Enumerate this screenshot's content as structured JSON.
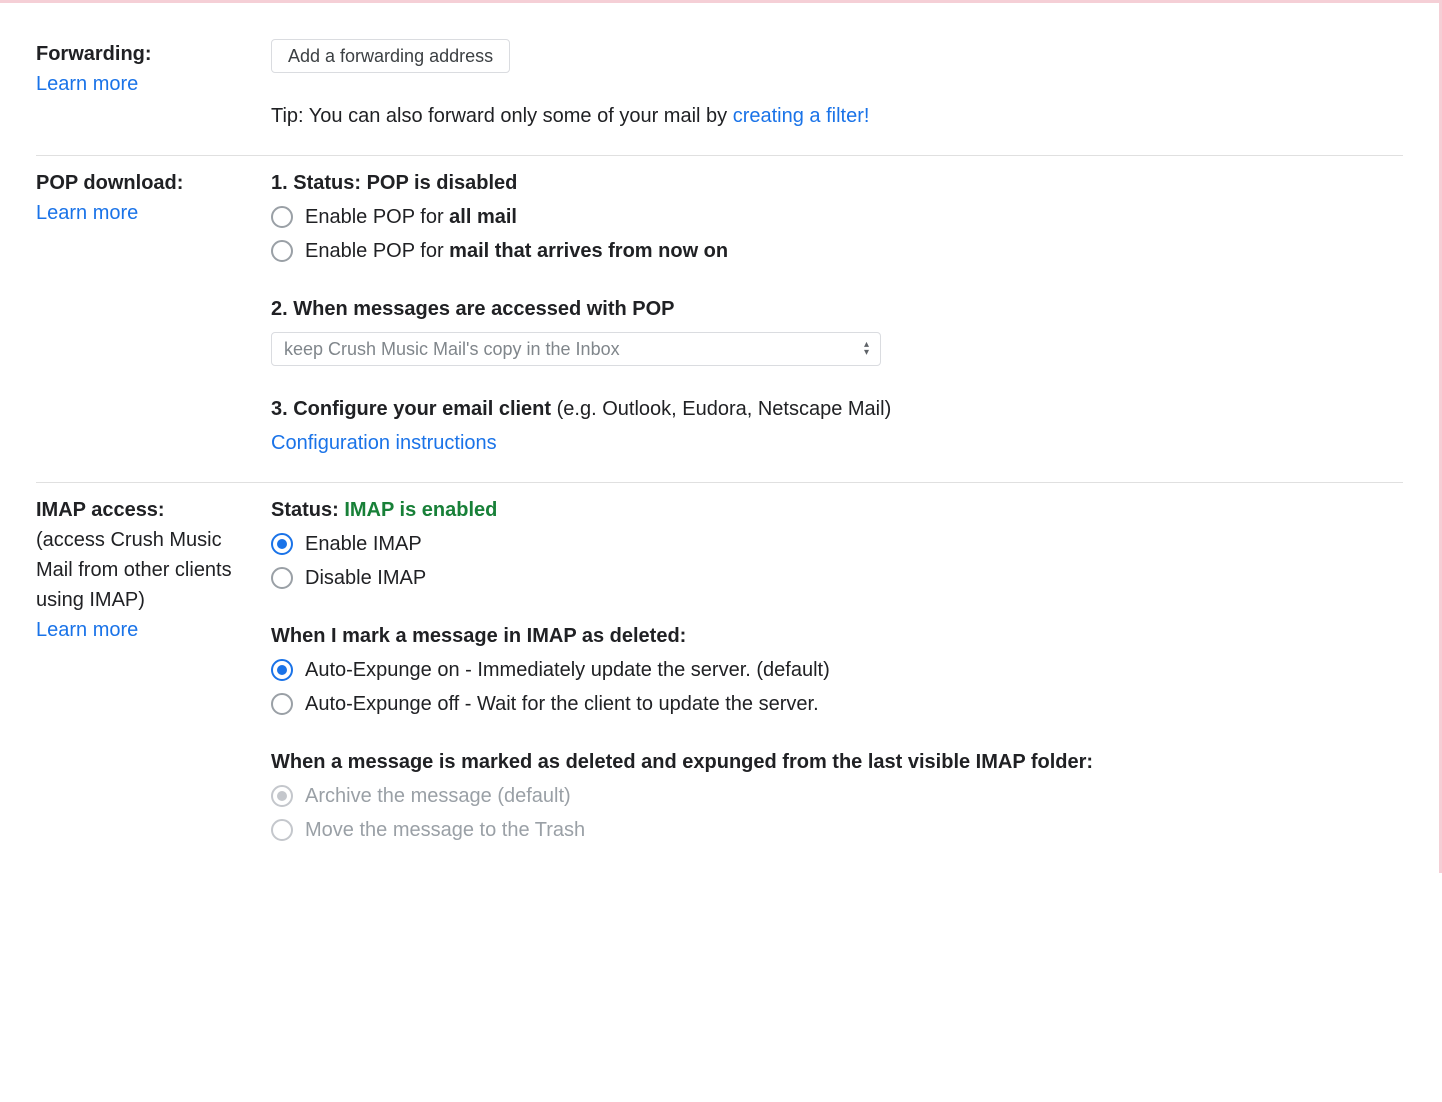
{
  "forwarding": {
    "title": "Forwarding:",
    "learn_more": "Learn more",
    "button_label": "Add a forwarding address",
    "tip_prefix": "Tip: You can also forward only some of your mail by ",
    "tip_link": "creating a filter!"
  },
  "pop": {
    "title": "POP download:",
    "learn_more": "Learn more",
    "status_prefix": "1. Status: ",
    "status_value": "POP is disabled",
    "opt_all_prefix": "Enable POP for ",
    "opt_all_bold": "all mail",
    "opt_now_prefix": "Enable POP for ",
    "opt_now_bold": "mail that arrives from now on",
    "step2": "2. When messages are accessed with POP",
    "select_value": "keep Crush Music Mail's copy in the Inbox",
    "step3_bold": "3. Configure your email client ",
    "step3_rest": "(e.g. Outlook, Eudora, Netscape Mail)",
    "config_link": "Configuration instructions"
  },
  "imap": {
    "title": "IMAP access:",
    "desc": "(access Crush Music Mail from other clients using IMAP)",
    "learn_more": "Learn more",
    "status_prefix": "Status: ",
    "status_value": "IMAP is enabled",
    "enable_label": "Enable IMAP",
    "disable_label": "Disable IMAP",
    "deleted_head": "When I mark a message in IMAP as deleted:",
    "expunge_on": "Auto-Expunge on - Immediately update the server. (default)",
    "expunge_off": "Auto-Expunge off - Wait for the client to update the server.",
    "expunged_head": "When a message is marked as deleted and expunged from the last visible IMAP folder:",
    "archive_label": "Archive the message (default)",
    "trash_label": "Move the message to the Trash"
  }
}
